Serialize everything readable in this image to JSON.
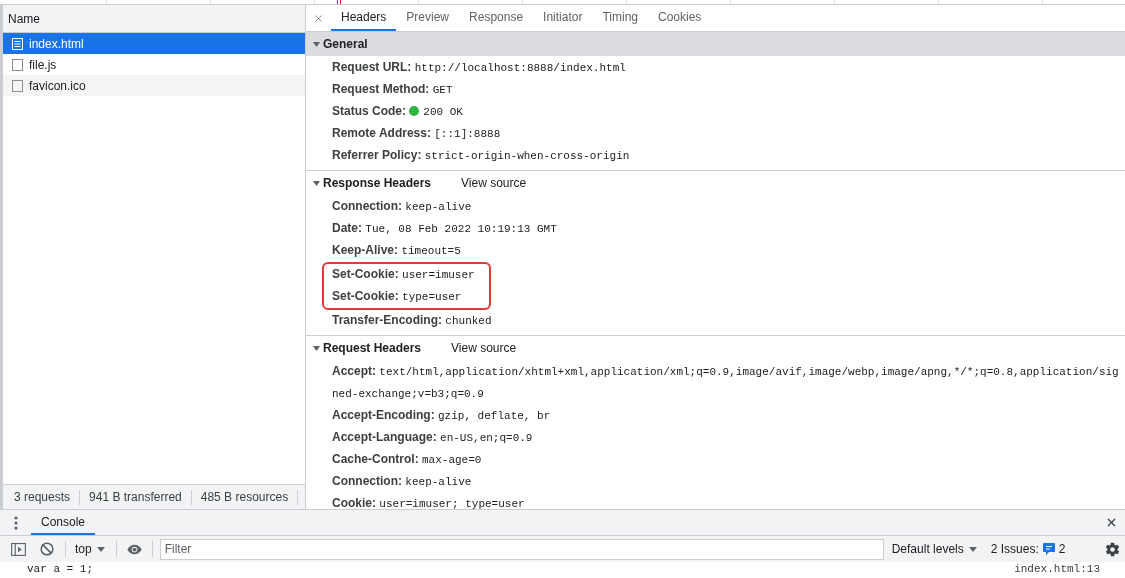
{
  "overview": {
    "markers": [
      {
        "color": "#1a73e8"
      },
      {
        "color": "#d93025"
      }
    ]
  },
  "requests_panel": {
    "column_header": "Name",
    "requests": [
      {
        "name": "index.html",
        "kind": "document",
        "selected": true
      },
      {
        "name": "file.js",
        "kind": "file",
        "selected": false
      },
      {
        "name": "favicon.ico",
        "kind": "file",
        "selected": false
      }
    ],
    "status_bar": [
      "3 requests",
      "941 B transferred",
      "485 B resources"
    ]
  },
  "details": {
    "tabs": [
      {
        "label": "Headers",
        "selected": true
      },
      {
        "label": "Preview",
        "selected": false
      },
      {
        "label": "Response",
        "selected": false
      },
      {
        "label": "Initiator",
        "selected": false
      },
      {
        "label": "Timing",
        "selected": false
      },
      {
        "label": "Cookies",
        "selected": false
      }
    ],
    "sections": [
      {
        "title": "General",
        "expanded": true,
        "selected": true,
        "rows": [
          {
            "name": "Request URL:",
            "value": "http://localhost:8888/index.html",
            "kind": "plain",
            "highlighted": false
          },
          {
            "name": "Request Method:",
            "value": "GET",
            "kind": "plain",
            "highlighted": false
          },
          {
            "name": "Status Code:",
            "value": "200 OK",
            "kind": "status",
            "highlighted": false
          },
          {
            "name": "Remote Address:",
            "value": "[::1]:8888",
            "kind": "plain",
            "highlighted": false
          },
          {
            "name": "Referrer Policy:",
            "value": "strict-origin-when-cross-origin",
            "kind": "plain",
            "highlighted": false
          }
        ]
      },
      {
        "title": "Response Headers",
        "link": "View source",
        "expanded": true,
        "selected": false,
        "rows": [
          {
            "name": "Connection:",
            "value": "keep-alive",
            "kind": "plain",
            "highlighted": false
          },
          {
            "name": "Date:",
            "value": "Tue, 08 Feb 2022 10:19:13 GMT",
            "kind": "plain",
            "highlighted": false
          },
          {
            "name": "Keep-Alive:",
            "value": "timeout=5",
            "kind": "plain",
            "highlighted": false
          },
          {
            "name": "Set-Cookie:",
            "value": "user=imuser",
            "kind": "plain",
            "highlighted": true
          },
          {
            "name": "Set-Cookie:",
            "value": "type=user",
            "kind": "plain",
            "highlighted": true
          },
          {
            "name": "Transfer-Encoding:",
            "value": "chunked",
            "kind": "plain",
            "highlighted": false
          }
        ]
      },
      {
        "title": "Request Headers",
        "link": "View source",
        "expanded": true,
        "selected": false,
        "rows": [
          {
            "name": "Accept:",
            "value": "text/html,application/xhtml+xml,application/xml;q=0.9,image/avif,image/webp,image/apng,*/*;q=0.8,application/signed-exchange;v=b3;q=0.9",
            "kind": "plain",
            "highlighted": false
          },
          {
            "name": "Accept-Encoding:",
            "value": "gzip, deflate, br",
            "kind": "plain",
            "highlighted": false
          },
          {
            "name": "Accept-Language:",
            "value": "en-US,en;q=0.9",
            "kind": "plain",
            "highlighted": false
          },
          {
            "name": "Cache-Control:",
            "value": "max-age=0",
            "kind": "plain",
            "highlighted": false
          },
          {
            "name": "Connection:",
            "value": "keep-alive",
            "kind": "plain",
            "highlighted": false
          },
          {
            "name": "Cookie:",
            "value": "user=imuser; type=user",
            "kind": "plain",
            "highlighted": false
          }
        ]
      }
    ]
  },
  "drawer": {
    "tabs": [
      {
        "label": "Console",
        "selected": true
      }
    ],
    "toolbar": {
      "context": "top",
      "filter_placeholder": "Filter",
      "levels": "Default levels",
      "issues_label": "2 Issues:",
      "issues_count": "2"
    },
    "messages": [
      {
        "text": "var a = 1;",
        "source": "index.html:13"
      }
    ]
  }
}
